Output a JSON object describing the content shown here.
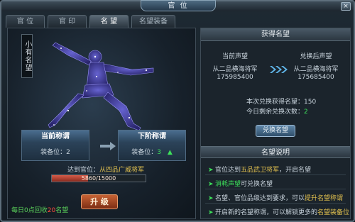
{
  "window": {
    "title": "官 位",
    "close_label": "×"
  },
  "tabs": [
    {
      "label": "官 位",
      "active": false
    },
    {
      "label": "官 印",
      "active": false
    },
    {
      "label": "名 望",
      "active": true
    },
    {
      "label": "名望装备",
      "active": false
    }
  ],
  "left": {
    "side_title": "小有名望",
    "current": {
      "title": "当前称谓",
      "slots_label": "装备位：",
      "slots": "2"
    },
    "next": {
      "title": "下阶称谓",
      "slots_label": "装备位：",
      "slots": "3"
    },
    "req_prefix": "达到官位：",
    "req_value": "从四品广威将军",
    "progress": {
      "text": "5860/15000",
      "fraction": 0.39
    },
    "upgrade_label": "升 级",
    "recycle": {
      "prefix": "每日0点回收",
      "amount": "20",
      "suffix": "名望"
    }
  },
  "right": {
    "header": "获得名望",
    "current_label": "当前声望",
    "after_label": "兑换后声望",
    "current_rank": "从二品横海将军",
    "current_value": "175985400",
    "after_rank": "从二品横海将军",
    "after_value": "175685400",
    "exchange_prefix": "本次兑换获得名望：",
    "exchange_value": "150",
    "remain_prefix": "今日剩余兑换次数：",
    "remain_value": "2",
    "exchange_button": "兑换名望",
    "desc_header": "名望说明",
    "desc": [
      {
        "pre": "官位达到",
        "hl": "五品武卫将军",
        "post": "，开启名望"
      },
      {
        "pre": "",
        "hl": "消耗声望",
        "post": "可兑换名望"
      },
      {
        "pre": "名望、官位品级达到要求，可以",
        "hl": "提升名望称谓",
        "post": ""
      },
      {
        "pre": "开启新的名望称谓，可以解锁更多的",
        "hl": "名望装备位",
        "post": ""
      }
    ]
  },
  "colors": {
    "highlight_yellow": "#e3c24f",
    "highlight_green": "#3ddf5a",
    "progress_red": "#d55d4a"
  }
}
